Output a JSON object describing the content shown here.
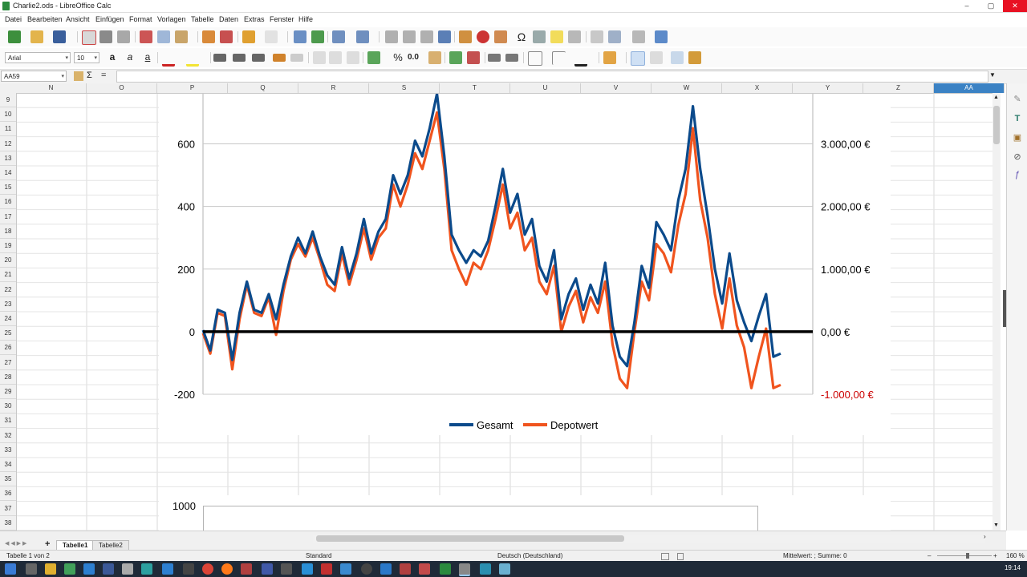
{
  "window": {
    "title": "Charlie2.ods - LibreOffice Calc",
    "buttons": {
      "minimize": "–",
      "maximize": "▢",
      "close": "✕"
    }
  },
  "menu": [
    "Datei",
    "Bearbeiten",
    "Ansicht",
    "Einfügen",
    "Format",
    "Vorlagen",
    "Tabelle",
    "Daten",
    "Extras",
    "Fenster",
    "Hilfe"
  ],
  "format_toolbar": {
    "font_name": "Arial",
    "font_size": "10",
    "percent_label": "%",
    "decimal_label": "0.0"
  },
  "formula_bar": {
    "name_box": "AA59",
    "sigma": "Σ",
    "equals": "=",
    "formula": ""
  },
  "columns": [
    "N",
    "O",
    "P",
    "Q",
    "R",
    "S",
    "T",
    "U",
    "V",
    "W",
    "X",
    "Y",
    "Z",
    "AA"
  ],
  "rows": [
    "9",
    "10",
    "11",
    "12",
    "13",
    "14",
    "15",
    "16",
    "17",
    "18",
    "19",
    "20",
    "21",
    "22",
    "23",
    "24",
    "25",
    "26",
    "27",
    "28",
    "29",
    "30",
    "31",
    "32",
    "33",
    "34",
    "35",
    "36",
    "37",
    "38"
  ],
  "chart_data": [
    {
      "type": "line",
      "title": "",
      "left_axis": {
        "ticks": [
          "600",
          "400",
          "200",
          "0",
          "-200"
        ],
        "ylim": [
          -200,
          760
        ]
      },
      "right_axis": {
        "ticks": [
          "3.000,00 €",
          "2.000,00 €",
          "1.000,00 €",
          "0,00 €",
          "-1.000,00 €"
        ],
        "negative_color": "#cc0000"
      },
      "zero_line": true,
      "grid": true,
      "legend": "bottom",
      "series": [
        {
          "name": "Gesamt",
          "color": "#0b4a8b",
          "points": [
            [
              0,
              5
            ],
            [
              2,
              -60
            ],
            [
              4,
              70
            ],
            [
              6,
              60
            ],
            [
              8,
              -90
            ],
            [
              10,
              60
            ],
            [
              12,
              160
            ],
            [
              14,
              70
            ],
            [
              16,
              60
            ],
            [
              18,
              120
            ],
            [
              20,
              40
            ],
            [
              22,
              150
            ],
            [
              24,
              240
            ],
            [
              26,
              300
            ],
            [
              28,
              250
            ],
            [
              30,
              320
            ],
            [
              32,
              240
            ],
            [
              34,
              180
            ],
            [
              36,
              150
            ],
            [
              38,
              270
            ],
            [
              40,
              170
            ],
            [
              42,
              250
            ],
            [
              44,
              360
            ],
            [
              46,
              250
            ],
            [
              48,
              320
            ],
            [
              50,
              360
            ],
            [
              52,
              500
            ],
            [
              54,
              440
            ],
            [
              56,
              500
            ],
            [
              58,
              610
            ],
            [
              60,
              560
            ],
            [
              62,
              650
            ],
            [
              64,
              760
            ],
            [
              66,
              560
            ],
            [
              68,
              310
            ],
            [
              70,
              260
            ],
            [
              72,
              220
            ],
            [
              74,
              260
            ],
            [
              76,
              240
            ],
            [
              78,
              290
            ],
            [
              80,
              400
            ],
            [
              82,
              520
            ],
            [
              84,
              380
            ],
            [
              86,
              440
            ],
            [
              88,
              310
            ],
            [
              90,
              360
            ],
            [
              92,
              210
            ],
            [
              94,
              160
            ],
            [
              96,
              260
            ],
            [
              98,
              40
            ],
            [
              100,
              120
            ],
            [
              102,
              170
            ],
            [
              104,
              70
            ],
            [
              106,
              150
            ],
            [
              108,
              90
            ],
            [
              110,
              220
            ],
            [
              112,
              20
            ],
            [
              114,
              -80
            ],
            [
              116,
              -110
            ],
            [
              118,
              30
            ],
            [
              120,
              210
            ],
            [
              122,
              140
            ],
            [
              124,
              350
            ],
            [
              126,
              310
            ],
            [
              128,
              260
            ],
            [
              130,
              420
            ],
            [
              132,
              520
            ],
            [
              134,
              720
            ],
            [
              136,
              520
            ],
            [
              138,
              370
            ],
            [
              140,
              200
            ],
            [
              142,
              90
            ],
            [
              144,
              250
            ],
            [
              146,
              100
            ],
            [
              148,
              30
            ],
            [
              150,
              -30
            ],
            [
              152,
              50
            ],
            [
              154,
              120
            ],
            [
              156,
              -80
            ],
            [
              158,
              -70
            ]
          ]
        },
        {
          "name": "Depotwert",
          "color": "#f0541e",
          "points": [
            [
              0,
              -5
            ],
            [
              2,
              -70
            ],
            [
              4,
              60
            ],
            [
              6,
              50
            ],
            [
              8,
              -120
            ],
            [
              10,
              40
            ],
            [
              12,
              150
            ],
            [
              14,
              60
            ],
            [
              16,
              50
            ],
            [
              18,
              110
            ],
            [
              20,
              -10
            ],
            [
              22,
              130
            ],
            [
              24,
              230
            ],
            [
              26,
              280
            ],
            [
              28,
              240
            ],
            [
              30,
              300
            ],
            [
              32,
              230
            ],
            [
              34,
              150
            ],
            [
              36,
              130
            ],
            [
              38,
              250
            ],
            [
              40,
              150
            ],
            [
              42,
              230
            ],
            [
              44,
              330
            ],
            [
              46,
              230
            ],
            [
              48,
              300
            ],
            [
              50,
              330
            ],
            [
              52,
              470
            ],
            [
              54,
              400
            ],
            [
              56,
              470
            ],
            [
              58,
              570
            ],
            [
              60,
              520
            ],
            [
              62,
              610
            ],
            [
              64,
              700
            ],
            [
              66,
              520
            ],
            [
              68,
              260
            ],
            [
              70,
              200
            ],
            [
              72,
              150
            ],
            [
              74,
              220
            ],
            [
              76,
              200
            ],
            [
              78,
              260
            ],
            [
              80,
              360
            ],
            [
              82,
              470
            ],
            [
              84,
              330
            ],
            [
              86,
              380
            ],
            [
              88,
              260
            ],
            [
              90,
              300
            ],
            [
              92,
              160
            ],
            [
              94,
              120
            ],
            [
              96,
              210
            ],
            [
              98,
              0
            ],
            [
              100,
              80
            ],
            [
              102,
              130
            ],
            [
              104,
              30
            ],
            [
              106,
              110
            ],
            [
              108,
              60
            ],
            [
              110,
              160
            ],
            [
              112,
              -40
            ],
            [
              114,
              -150
            ],
            [
              116,
              -180
            ],
            [
              118,
              0
            ],
            [
              120,
              160
            ],
            [
              122,
              100
            ],
            [
              124,
              280
            ],
            [
              126,
              250
            ],
            [
              128,
              190
            ],
            [
              130,
              340
            ],
            [
              132,
              440
            ],
            [
              134,
              650
            ],
            [
              136,
              420
            ],
            [
              138,
              300
            ],
            [
              140,
              120
            ],
            [
              142,
              10
            ],
            [
              144,
              170
            ],
            [
              146,
              20
            ],
            [
              148,
              -50
            ],
            [
              150,
              -180
            ],
            [
              152,
              -80
            ],
            [
              154,
              10
            ],
            [
              156,
              -180
            ],
            [
              158,
              -170
            ]
          ]
        }
      ]
    },
    {
      "type": "line",
      "left_axis": {
        "ticks": [
          "1000"
        ]
      },
      "title": "",
      "series": []
    }
  ],
  "sheet_tabs": [
    "Tabelle1",
    "Tabelle2"
  ],
  "status": {
    "sheet": "Tabelle 1 von 2",
    "style": "Standard",
    "language": "Deutsch (Deutschland)",
    "summary": "Mittelwert: ; Summe: 0",
    "zoom": "160 %"
  },
  "taskbar": {
    "clock": "19:14"
  }
}
